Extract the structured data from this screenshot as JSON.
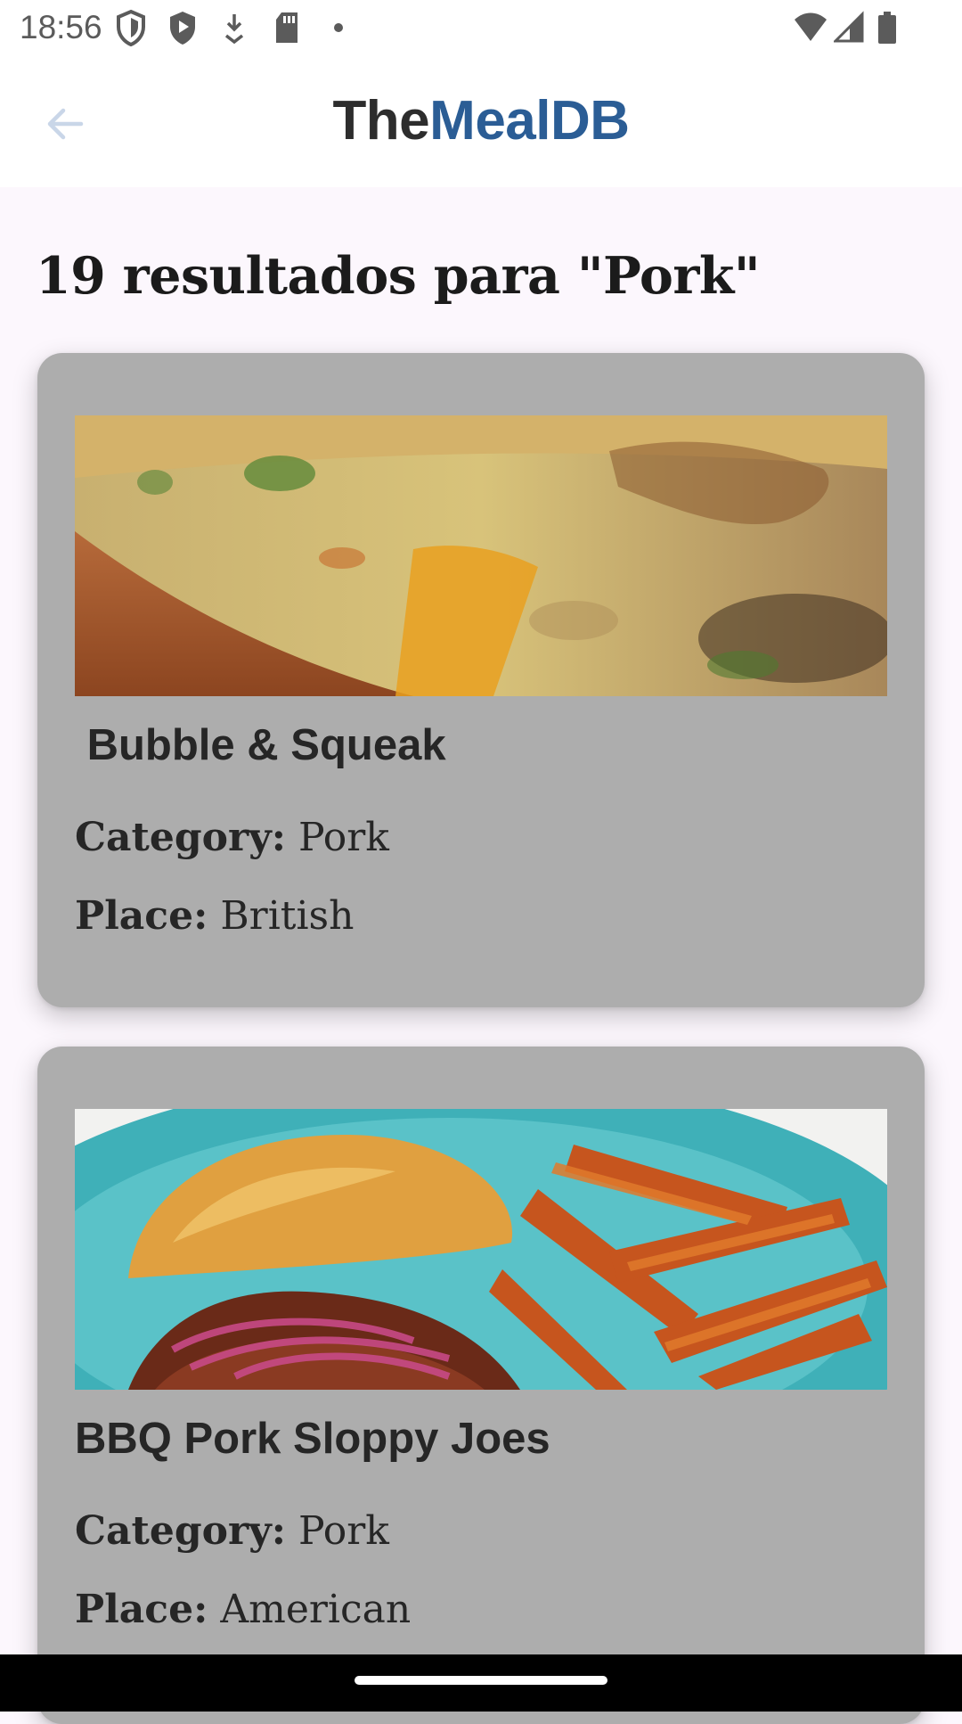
{
  "status_bar": {
    "time": "18:56",
    "icons": [
      "shield-outline-icon",
      "shield-play-icon",
      "download-icon",
      "sd-card-icon",
      "dot-icon",
      "wifi-icon",
      "signal-icon",
      "battery-icon"
    ]
  },
  "app_bar": {
    "back_icon": "arrow-left-icon",
    "title_part1": "The",
    "title_part2": "MealDB",
    "title_color_dark": "#2d2d2d",
    "title_color_accent": "#2b5d95"
  },
  "results": {
    "heading": "19 resultados para \"Pork\""
  },
  "meals": [
    {
      "title": " Bubble & Squeak",
      "category_label": "Category:",
      "category": "Pork",
      "place_label": "Place:",
      "place": "British",
      "image_desc": "bubble-and-squeak-photo"
    },
    {
      "title": "BBQ Pork Sloppy Joes",
      "category_label": "Category:",
      "category": "Pork",
      "place_label": "Place:",
      "place": "American",
      "image_desc": "bbq-pork-sloppy-joes-photo"
    }
  ],
  "colors": {
    "page_background": "#fcf7fd",
    "card_background": "#adadad"
  }
}
